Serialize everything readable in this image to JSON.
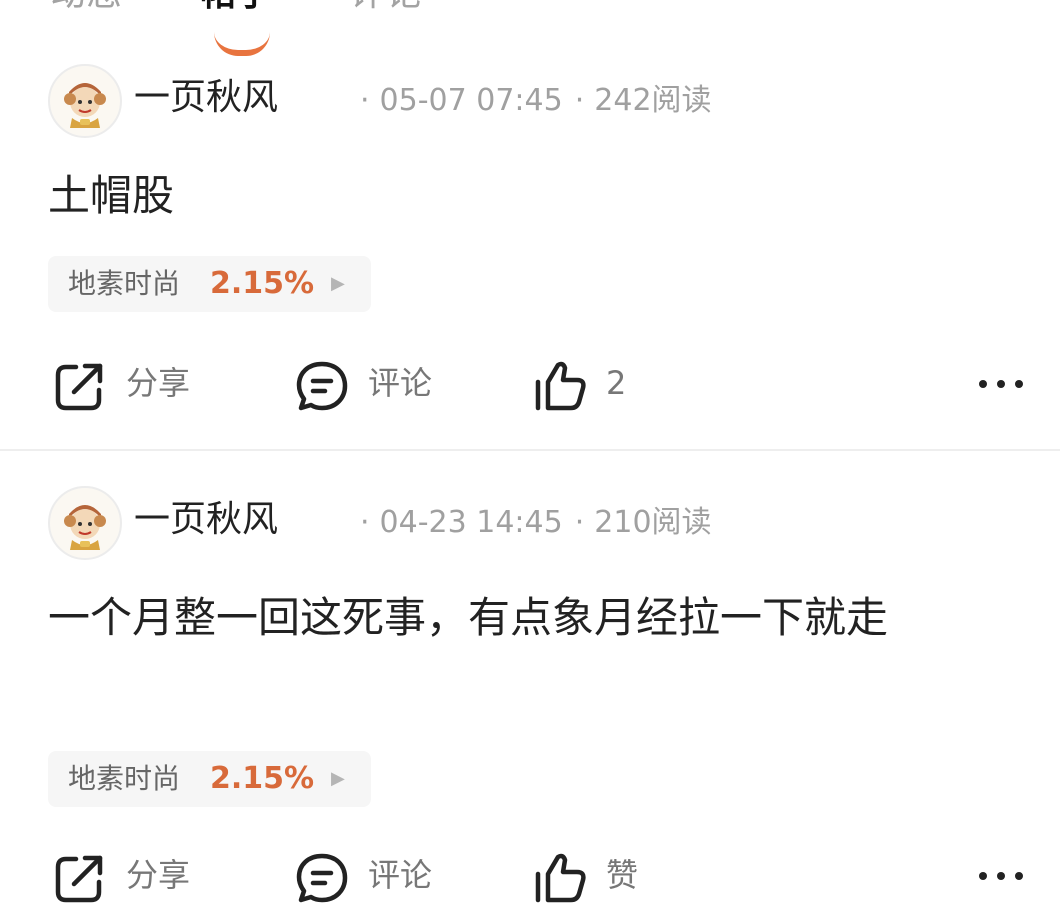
{
  "tabs": [
    {
      "label": "动态",
      "active": false
    },
    {
      "label": "帖子",
      "active": true
    },
    {
      "label": "评论",
      "active": false
    }
  ],
  "colors": {
    "accent": "#e8743f",
    "stock_change": "#d86a3a",
    "meta_gray": "#a0a0a0"
  },
  "posts": [
    {
      "author": "一页秋风",
      "date": "05-07 07:45",
      "reads": "242阅读",
      "content": "土帽股",
      "stock": {
        "name": "地素时尚",
        "change": "2.15%"
      },
      "actions": {
        "share": "分享",
        "comment": "评论",
        "like": "2"
      }
    },
    {
      "author": "一页秋风",
      "date": "04-23 14:45",
      "reads": "210阅读",
      "content": "一个月整一回这死事，有点象月经拉一下就走",
      "stock": {
        "name": "地素时尚",
        "change": "2.15%"
      },
      "actions": {
        "share": "分享",
        "comment": "评论",
        "like": "赞"
      }
    }
  ],
  "icons": {
    "share": "share-icon",
    "comment": "comment-icon",
    "like": "thumbs-up-icon",
    "more": "more-icon",
    "stock_arrow": "play-arrow-icon",
    "avatar": "avatar-cartoon"
  }
}
